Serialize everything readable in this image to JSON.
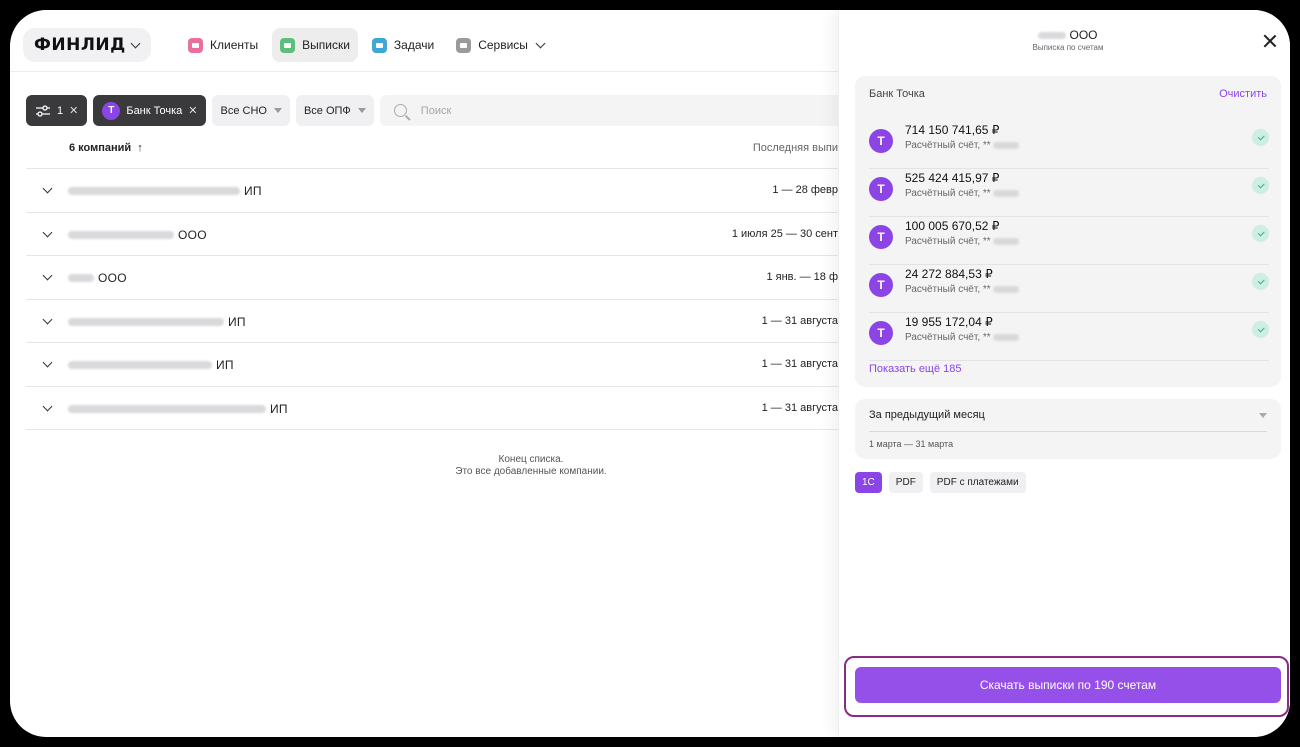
{
  "logo": "ФИНЛИД",
  "nav": [
    {
      "label": "Клиенты",
      "color": "#e8709e"
    },
    {
      "label": "Выписки",
      "color": "#5cbf7e"
    },
    {
      "label": "Задачи",
      "color": "#3fa6d6"
    },
    {
      "label": "Сервисы",
      "color": "#9a9a9e"
    }
  ],
  "filters": {
    "settings_count": "1",
    "bank_chip": "Банк Точка",
    "bank_badge": "Т",
    "sno": "Все СНО",
    "opf": "Все ОПФ",
    "search_placeholder": "Поиск"
  },
  "table": {
    "count_header": "6 компаний",
    "last_header": "Последняя выпи",
    "rows": [
      {
        "form": "ИП",
        "period": "1 — 28 февр"
      },
      {
        "form": "ООО",
        "period": "1 июля 25 — 30 сент"
      },
      {
        "form": "ООО",
        "period": "1 янв. — 18 ф"
      },
      {
        "form": "ИП",
        "period": "1 — 31 августа"
      },
      {
        "form": "ИП",
        "period": "1 — 31 августа"
      },
      {
        "form": "ИП",
        "period": "1 — 31 августа"
      }
    ],
    "end_line1": "Конец списка.",
    "end_line2": "Это все добавленные компании."
  },
  "panel": {
    "company_form": "ООО",
    "subtitle": "Выписка по счетам",
    "bank_name": "Банк Точка",
    "clear": "Очистить",
    "accounts": [
      {
        "amount": "714 150 741,65 ₽",
        "label": "Расчётный счёт, **"
      },
      {
        "amount": "525 424 415,97 ₽",
        "label": "Расчётный счёт, **"
      },
      {
        "amount": "100 005 670,52 ₽",
        "label": "Расчётный счёт, **"
      },
      {
        "amount": "24 272 884,53 ₽",
        "label": "Расчётный счёт, **"
      },
      {
        "amount": "19 955 172,04 ₽",
        "label": "Расчётный счёт, **"
      }
    ],
    "show_more": "Показать ещё 185",
    "period_select": "За предыдущий месяц",
    "period_range": "1 марта — 31 марта",
    "formats": [
      "1С",
      "PDF",
      "PDF с платежами"
    ],
    "download_button": "Скачать выписки по 190 счетам"
  },
  "colors": {
    "accent": "#8b45e6",
    "highlight_outline": "#8a2c83",
    "check_green": "#3bb58a"
  }
}
